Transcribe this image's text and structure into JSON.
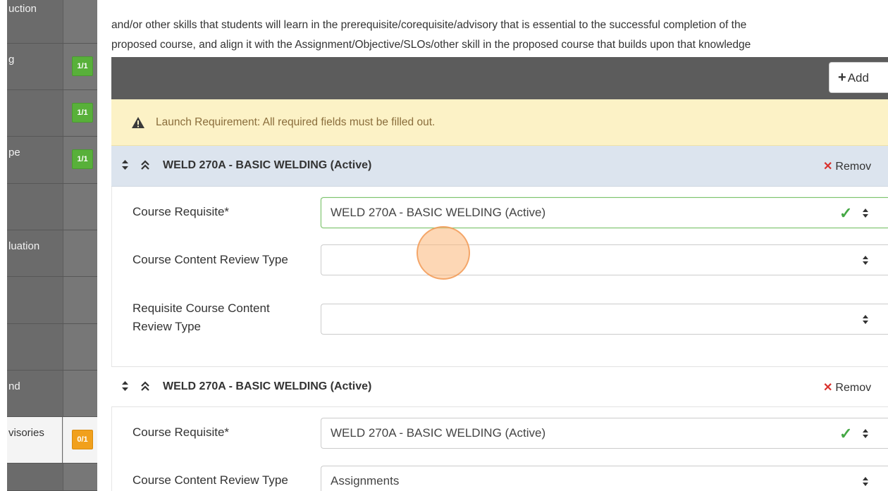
{
  "sidebar": {
    "items": [
      {
        "label": "uction",
        "badge": ""
      },
      {
        "label": "g",
        "badge": "1/1",
        "badge_color": "#58b03a"
      },
      {
        "label": "",
        "badge": "1/1",
        "badge_color": "#58b03a"
      },
      {
        "label": "pe",
        "badge": "1/1",
        "badge_color": "#58b03a"
      },
      {
        "label": "",
        "badge": ""
      },
      {
        "label": "luation",
        "badge": ""
      },
      {
        "label": "",
        "badge": ""
      },
      {
        "label": "",
        "badge": ""
      },
      {
        "label": "nd",
        "badge": ""
      },
      {
        "label": "visories",
        "badge": "0/1",
        "badge_color": "#f1a01c",
        "active": true
      },
      {
        "label": "",
        "badge": ""
      }
    ]
  },
  "intro": {
    "line1": "and/or other skills that students will learn in the prerequisite/corequisite/advisory that is essential to the successful completion of the",
    "line2": "proposed course, and align it with the Assignment/Objective/SLOs/other skill in the proposed course that builds upon that knowledge"
  },
  "toolbar": {
    "add_label": "Add"
  },
  "warning": {
    "text": "Launch Requirement: All required fields must be filled out."
  },
  "requisites": [
    {
      "title": "WELD 270A - BASIC WELDING (Active)",
      "remove_label": "Remov",
      "fields": {
        "course_requisite_label": "Course Requisite*",
        "course_requisite_value": "WELD 270A - BASIC WELDING (Active)",
        "content_review_label": "Course Content Review Type",
        "content_review_value": "",
        "req_content_review_label_1": "Requisite Course Content",
        "req_content_review_label_2": "Review Type",
        "req_content_review_value": ""
      }
    },
    {
      "title": "WELD 270A - BASIC WELDING (Active)",
      "remove_label": "Remov",
      "fields": {
        "course_requisite_label": "Course Requisite*",
        "course_requisite_value": "WELD 270A - BASIC WELDING (Active)",
        "content_review_label": "Course Content Review Type",
        "content_review_value": "Assignments"
      }
    }
  ],
  "icons": {
    "warning": "warning-triangle-icon",
    "sort": "sort-arrows-icon",
    "collapse": "chevron-double-up-icon",
    "remove": "x-icon",
    "check": "check-icon",
    "caret": "select-caret-icon"
  },
  "colors": {
    "badge_complete": "#58b03a",
    "badge_incomplete": "#f1a01c",
    "warning_bg": "#fcf2c6",
    "warning_text": "#8a6d3b",
    "section_header_bg": "#dce4ee",
    "remove_x": "#d9302c",
    "valid_check": "#45a845"
  }
}
